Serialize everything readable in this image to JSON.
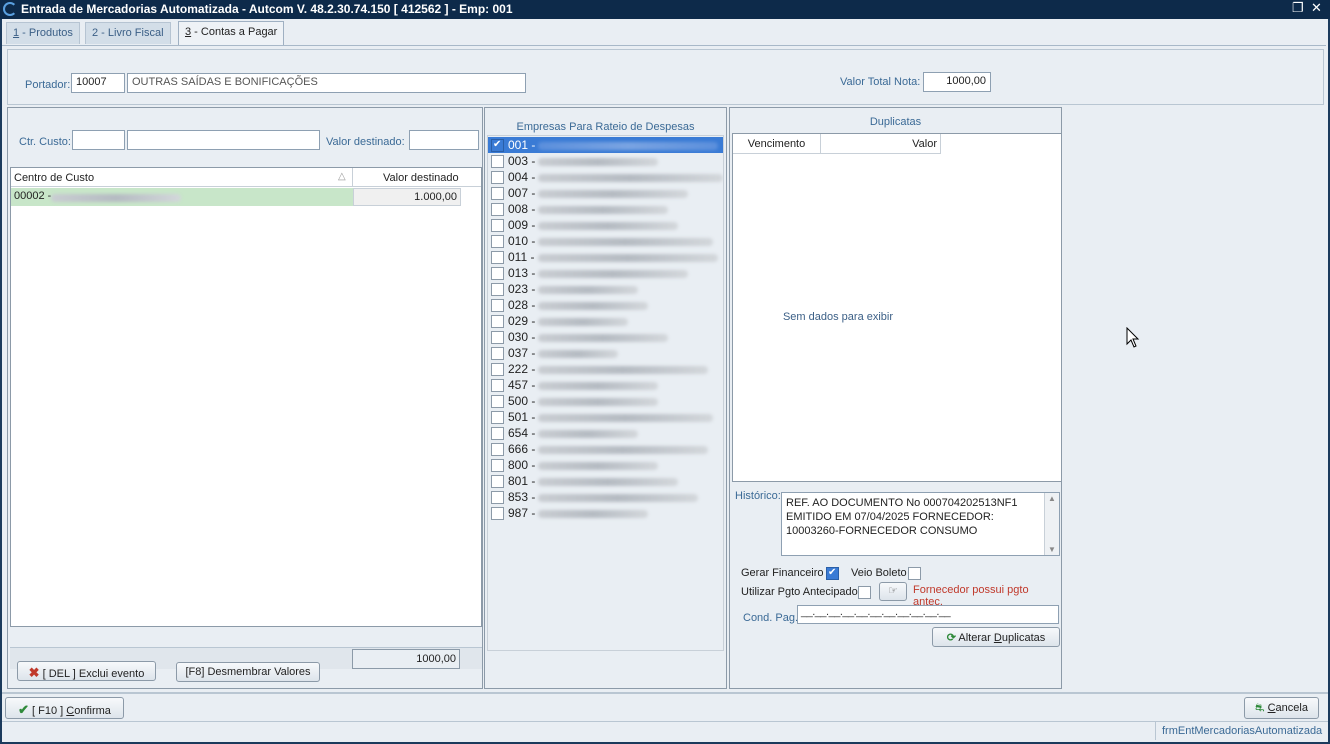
{
  "window": {
    "title": "Entrada de Mercadorias Automatizada   -   Autcom V. 48.2.30.74.150 [ 412562 ] - Emp: 001",
    "restore_icon": "restore-icon",
    "close_icon": "close-icon"
  },
  "tabs": [
    {
      "num": "1",
      "label": " - Produtos"
    },
    {
      "num": "2",
      "label": " - Livro Fiscal"
    },
    {
      "num": "3",
      "label": " - Contas a Pagar"
    }
  ],
  "header": {
    "portador_label": "Portador:",
    "portador_code": "10007",
    "portador_name": "OUTRAS SAÍDAS E BONIFICAÇÕES",
    "valor_total_label": "Valor Total Nota:",
    "valor_total": "1000,00"
  },
  "cost": {
    "ctr_label": "Ctr. Custo:",
    "valor_dest_label": "Valor destinado:",
    "columns": [
      "Centro de Custo",
      "Valor destinado"
    ],
    "rows": [
      {
        "codigo": "00002 -",
        "valor": "1.000,00"
      }
    ],
    "total": "1000,00",
    "btn_exclui": "[ DEL ] Exclui evento",
    "btn_desmembrar": "[F8] Desmembrar Valores"
  },
  "empresas": {
    "title": "Empresas Para Rateio de Despesas",
    "items": [
      {
        "code": "001 -",
        "checked": true
      },
      {
        "code": "003 -",
        "checked": false
      },
      {
        "code": "004 -",
        "checked": false
      },
      {
        "code": "007 -",
        "checked": false
      },
      {
        "code": "008 -",
        "checked": false
      },
      {
        "code": "009 -",
        "checked": false
      },
      {
        "code": "010 -",
        "checked": false
      },
      {
        "code": "011 -",
        "checked": false
      },
      {
        "code": "013 -",
        "checked": false
      },
      {
        "code": "023 -",
        "checked": false
      },
      {
        "code": "028 -",
        "checked": false
      },
      {
        "code": "029 -",
        "checked": false
      },
      {
        "code": "030 -",
        "checked": false
      },
      {
        "code": "037 -",
        "checked": false
      },
      {
        "code": "222 -",
        "checked": false
      },
      {
        "code": "457 -",
        "checked": false
      },
      {
        "code": "500 -",
        "checked": false
      },
      {
        "code": "501 -",
        "checked": false
      },
      {
        "code": "654 -",
        "checked": false
      },
      {
        "code": "666 -",
        "checked": false
      },
      {
        "code": "800 -",
        "checked": false
      },
      {
        "code": "801 -",
        "checked": false
      },
      {
        "code": "853 -",
        "checked": false
      },
      {
        "code": "987 -",
        "checked": false
      }
    ]
  },
  "duplicatas": {
    "title": "Duplicatas",
    "columns": [
      "Vencimento",
      "Valor"
    ],
    "empty": "Sem dados para exibir",
    "historico_label": "Histórico:",
    "historico": "REF. AO DOCUMENTO No 000704202513NF1 EMITIDO EM 07/04/2025 FORNECEDOR: 10003260-FORNECEDOR CONSUMO",
    "gerar_financeiro": "Gerar Financeiro",
    "gerar_checked": true,
    "veio_boleto": "Veio Boleto",
    "utilizar_pgto": "Utilizar Pgto Antecipado",
    "aviso": "Fornecedor possui pgto antec.",
    "cond_pag_label": "Cond. Pag.:",
    "cond_pag_mask": "__.__.__.__.__.__.__.__.__.__.__",
    "btn_alterar_pre": "Alterar ",
    "btn_alterar_u": "D",
    "btn_alterar_post": "uplicatas"
  },
  "footer": {
    "confirma_pre": "[ F10 ] ",
    "confirma_u": "C",
    "confirma_post": "onfirma",
    "cancela_u": "C",
    "cancela_post": "ancela",
    "status": "frmEntMercadoriasAutomatizada"
  },
  "colors": {
    "titlebar": "#0d2a4a",
    "selected_row": "#c8e6c9",
    "highlight": "#3a7bd5",
    "warning": "#c0392b"
  }
}
